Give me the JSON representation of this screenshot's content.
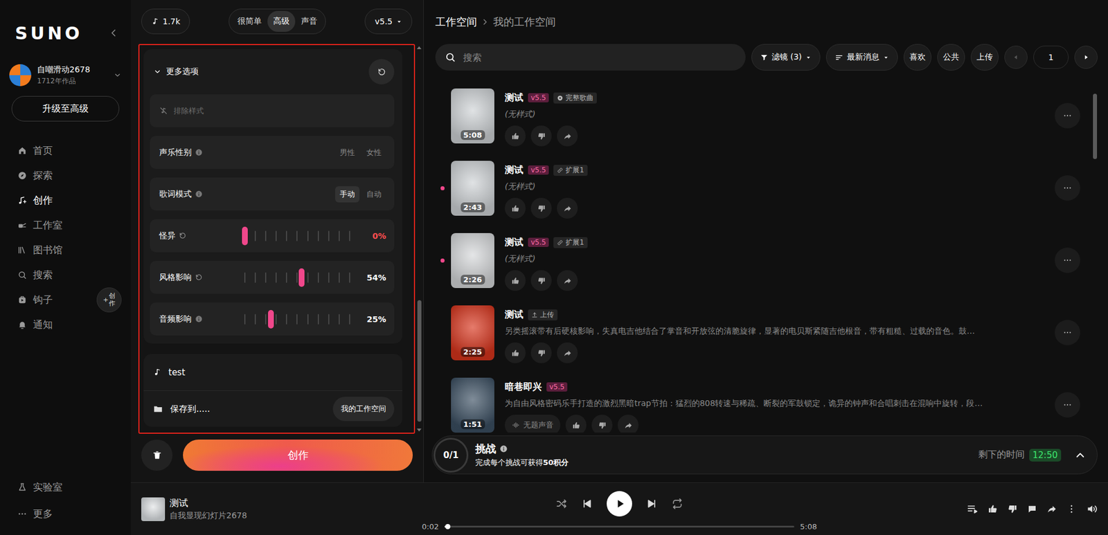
{
  "sidebar": {
    "logo": "SUNO",
    "user": {
      "name": "自嘲滑动2678",
      "works": "1712年作品"
    },
    "upgrade": "升级至高级",
    "nav": [
      {
        "label": "首页",
        "selected": false
      },
      {
        "label": "探索",
        "selected": false
      },
      {
        "label": "创作",
        "selected": true
      },
      {
        "label": "工作室",
        "selected": false
      },
      {
        "label": "图书馆",
        "selected": false
      },
      {
        "label": "搜索",
        "selected": false
      },
      {
        "label": "钩子",
        "selected": false
      },
      {
        "label": "通知",
        "selected": false
      }
    ],
    "hook_create": {
      "plus": "+",
      "label": "创作"
    },
    "footer": [
      {
        "label": "实验室"
      },
      {
        "label": "更多"
      }
    ]
  },
  "creator": {
    "credits": "1.7k",
    "modes": [
      {
        "label": "很简单",
        "selected": false
      },
      {
        "label": "高级",
        "selected": true
      },
      {
        "label": "声音",
        "selected": false
      }
    ],
    "version": "v5.5",
    "more_options": {
      "title": "更多选项",
      "expanded": true,
      "exclude_placeholder": "排除样式",
      "rows": [
        {
          "kind": "choice",
          "label": "声乐性别",
          "options": [
            {
              "label": "男性",
              "selected": false
            },
            {
              "label": "女性",
              "selected": false
            }
          ]
        },
        {
          "kind": "choice",
          "label": "歌词模式",
          "options": [
            {
              "label": "手动",
              "selected": true
            },
            {
              "label": "自动",
              "selected": false
            }
          ]
        },
        {
          "kind": "slider",
          "label": "怪异",
          "modified": true,
          "level": 0,
          "reading": "0%",
          "color": "#ff4d4f"
        },
        {
          "kind": "slider",
          "label": "风格影响",
          "modified": true,
          "level": 0.54,
          "reading": "54%",
          "color": "#ffffff"
        },
        {
          "kind": "slider",
          "label": "音频影响",
          "modified": false,
          "level": 0.25,
          "reading": "25%",
          "color": "#ffffff"
        }
      ]
    },
    "song_title": "test",
    "save_label": "保存到.....",
    "save_target": "我的工作空间",
    "create_button": "创作"
  },
  "workspace": {
    "breadcrumb": [
      {
        "label": "工作空间",
        "current": false
      },
      {
        "label": "我的工作空间",
        "current": true
      }
    ],
    "search_placeholder": "搜索",
    "filter": "滤镜 (3)",
    "sort": "最新消息",
    "buttons": [
      "喜欢",
      "公共",
      "上传"
    ],
    "pager": {
      "page": "1",
      "prev_disabled": true,
      "next_disabled": false
    },
    "songs": [
      {
        "title": "测试",
        "version": "v5.5",
        "badge": {
          "kind": "full",
          "label": "完整歌曲"
        },
        "subtitle": "(无样式)",
        "subtitle_italic": true,
        "duration": "5:08",
        "unplayed": false,
        "color": "#cfd3d6"
      },
      {
        "title": "测试",
        "version": "v5.5",
        "badge": {
          "kind": "extend",
          "label": "扩展1"
        },
        "subtitle": "(无样式)",
        "subtitle_italic": true,
        "duration": "2:43",
        "unplayed": true,
        "color": "#cfd3d6"
      },
      {
        "title": "测试",
        "version": "v5.5",
        "badge": {
          "kind": "extend",
          "label": "扩展1"
        },
        "subtitle": "(无样式)",
        "subtitle_italic": true,
        "duration": "2:26",
        "unplayed": true,
        "color": "#d6d8da"
      },
      {
        "title": "测试",
        "badge": {
          "kind": "upload",
          "label": "上传"
        },
        "subtitle": "另类摇滚带有后硬核影响，失真电吉他结合了掌音和开放弦的清脆旋律，显著的电贝斯紧随吉他根音，带有粗糙、过载的音色。鼓…",
        "subtitle_italic": false,
        "duration": "2:25",
        "unplayed": false,
        "color": "#d8341c"
      },
      {
        "title": "暗巷即兴",
        "version": "v5.5",
        "subtitle": "为自由风格密码乐手打造的激烈黑暗trap节拍：猛烈的808转速与稀疏、断裂的军鼓锁定，诡异的钟声和合唱刺击在混响中旋转，段…",
        "subtitle_italic": false,
        "duration": "1:51",
        "unplayed": false,
        "color": "#3b4f62",
        "voice": "无题声音"
      }
    ]
  },
  "challenge": {
    "count": "0/1",
    "title": "挑战",
    "desc": "完成每个挑战可获得",
    "desc_bold": "50积分",
    "time_label": "剩下的时间",
    "time": "12:50"
  },
  "player": {
    "title": "测试",
    "artist": "自我显现幻灯片2678",
    "elapsed": "0:02",
    "total": "5:08",
    "level": 0.01,
    "playing": false
  }
}
